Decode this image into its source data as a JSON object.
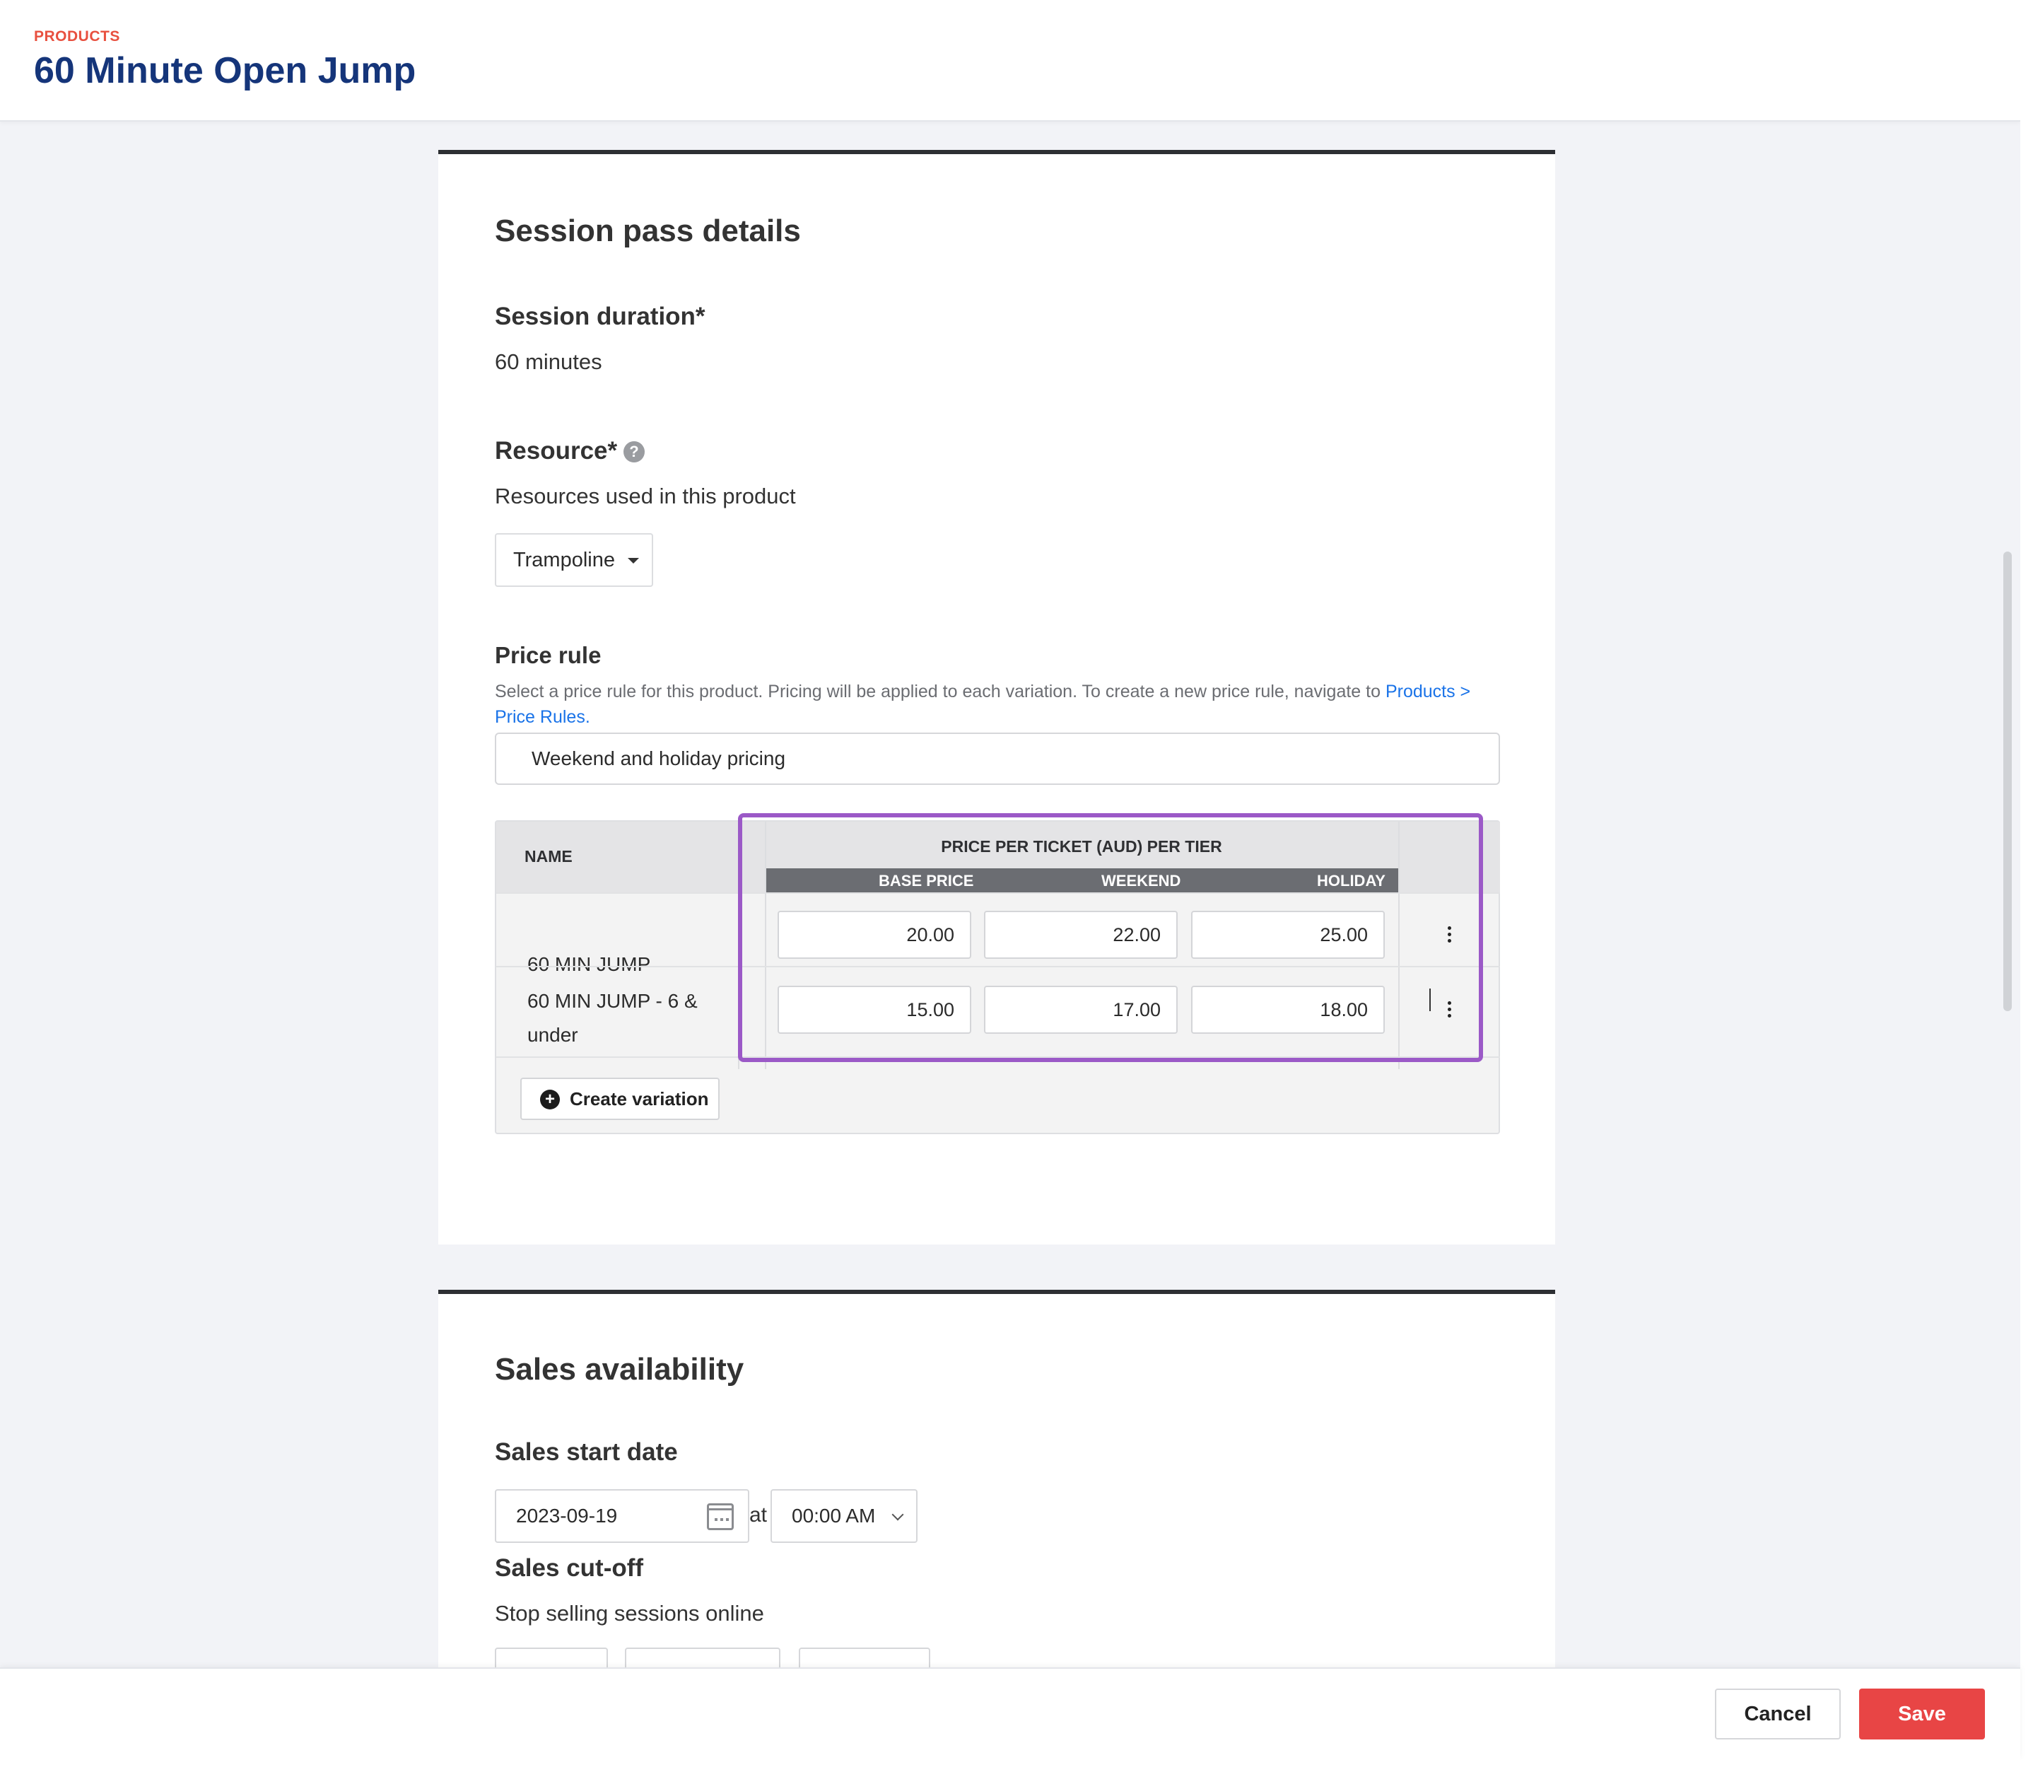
{
  "header": {
    "breadcrumb": "PRODUCTS",
    "title": "60 Minute Open Jump"
  },
  "session_pass": {
    "section_title": "Session pass details",
    "duration_label": "Session duration*",
    "duration_value": "60 minutes",
    "resource_label": "Resource*",
    "resource_help_icon": "question-circle-icon",
    "resource_description": "Resources used in this product",
    "resource_selected": "Trampoline",
    "price_rule_label": "Price rule",
    "price_rule_description": "Select a price rule for this product. Pricing will be applied to each variation. To create a new price rule, navigate to ",
    "price_rule_link": "Products > Price Rules",
    "price_rule_link_suffix": ".",
    "price_rule_value": "Weekend and holiday pricing"
  },
  "price_table": {
    "name_header": "NAME",
    "tier_header": "PRICE PER TICKET (AUD) PER TIER",
    "tier_columns": [
      "BASE PRICE",
      "WEEKEND",
      "HOLIDAY"
    ],
    "rows": [
      {
        "name": "60 MIN JUMP",
        "prices": [
          "20.00",
          "22.00",
          "25.00"
        ]
      },
      {
        "name": "60 MIN JUMP - 6 & under",
        "prices": [
          "15.00",
          "17.00",
          "18.00"
        ]
      }
    ],
    "create_variation_label": "Create variation",
    "highlight_color": "#9b59c7"
  },
  "sales_availability": {
    "section_title": "Sales availability",
    "start_date_label": "Sales start date",
    "start_date_value": "2023-09-19",
    "at_label": "at",
    "start_time_value": "00:00 AM",
    "cutoff_label": "Sales cut-off",
    "cutoff_description": "Stop selling sessions online"
  },
  "footer": {
    "cancel_label": "Cancel",
    "save_label": "Save",
    "save_color": "#e84545"
  },
  "colors": {
    "title": "#15357a",
    "breadcrumb": "#e8503f",
    "link": "#1a73e8"
  }
}
